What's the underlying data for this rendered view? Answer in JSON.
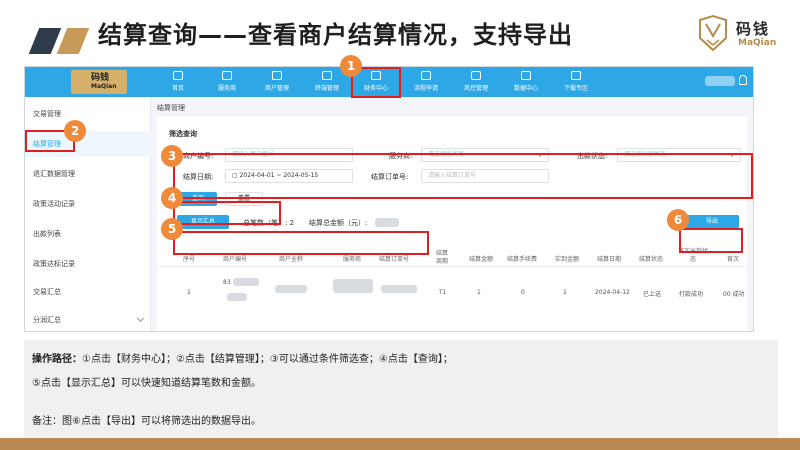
{
  "slide": {
    "title": "结算查询——查看商户结算情况，支持导出",
    "logo_cn": "码钱",
    "logo_en": "MaQian"
  },
  "app": {
    "logo_cn": "码钱",
    "logo_en": "MaQian",
    "nav": [
      "首页",
      "服务商",
      "商户管理",
      "终端管理",
      "财务中心",
      "流程申请",
      "风控管理",
      "数据中心",
      "下载专区"
    ],
    "sidebar": [
      "交易管理",
      "结算管理",
      "退汇数据管理",
      "政策活动记录",
      "出款列表",
      "政策达标记录",
      "交易汇总",
      "分润汇总"
    ],
    "breadcrumb": "结算管理",
    "filter": {
      "section_title": "筛选查询",
      "merchant_no_label": "商户编号:",
      "merchant_no_placeholder": "请输入商户编号",
      "service_label": "服务商:",
      "service_placeholder": "请选择服务商",
      "payout_status_label": "出款状态:",
      "payout_status_placeholder": "请选择出款状态",
      "settle_date_label": "结算日期:",
      "date_start": "2024-04-01",
      "date_sep": "~",
      "date_end": "2024-05-15",
      "order_no_label": "结算订单号:",
      "order_no_placeholder": "请输入结算订单号",
      "query_btn": "查询",
      "reset_btn": "重置"
    },
    "summary": {
      "show_btn": "显示汇总",
      "count_text": "总笔数（笔）: 2",
      "amount_text": "结算总金额（元）:",
      "export_btn": "导出"
    },
    "table": {
      "headers": [
        "序号",
        "商户编号",
        "商户全称",
        "服务商",
        "结算订单号",
        "结算周期",
        "结算金额",
        "结算手续费",
        "实到金额",
        "结算日期",
        "结算状态",
        "首次出款状态",
        "首次"
      ],
      "row": {
        "index": "1",
        "merchant_no": "83",
        "cycle": "T1",
        "amount": "1",
        "fee": "0",
        "actual": "1",
        "date": "2024-04-12",
        "settle_status": "已上送",
        "payout_status": "打款成功",
        "extra": "00 成功"
      }
    }
  },
  "annotations": [
    "1",
    "2",
    "3",
    "4",
    "5",
    "6"
  ],
  "notes": {
    "line1_label": "操作路径：",
    "line1_text": "①点击【财务中心】；②点击【结算管理】；③可以通过条件筛选查；④点击【查询】；",
    "line2": "⑤点击【显示汇总】可以快速知道结算笔数和金额。",
    "line3": "备注：图⑥点击【导出】可以将筛选出的数据导出。"
  },
  "colors": {
    "primary": "#2ea7e7",
    "annotation_box": "#e02020",
    "badge": "#ee8a3a",
    "brand_gold": "#b98a52"
  }
}
